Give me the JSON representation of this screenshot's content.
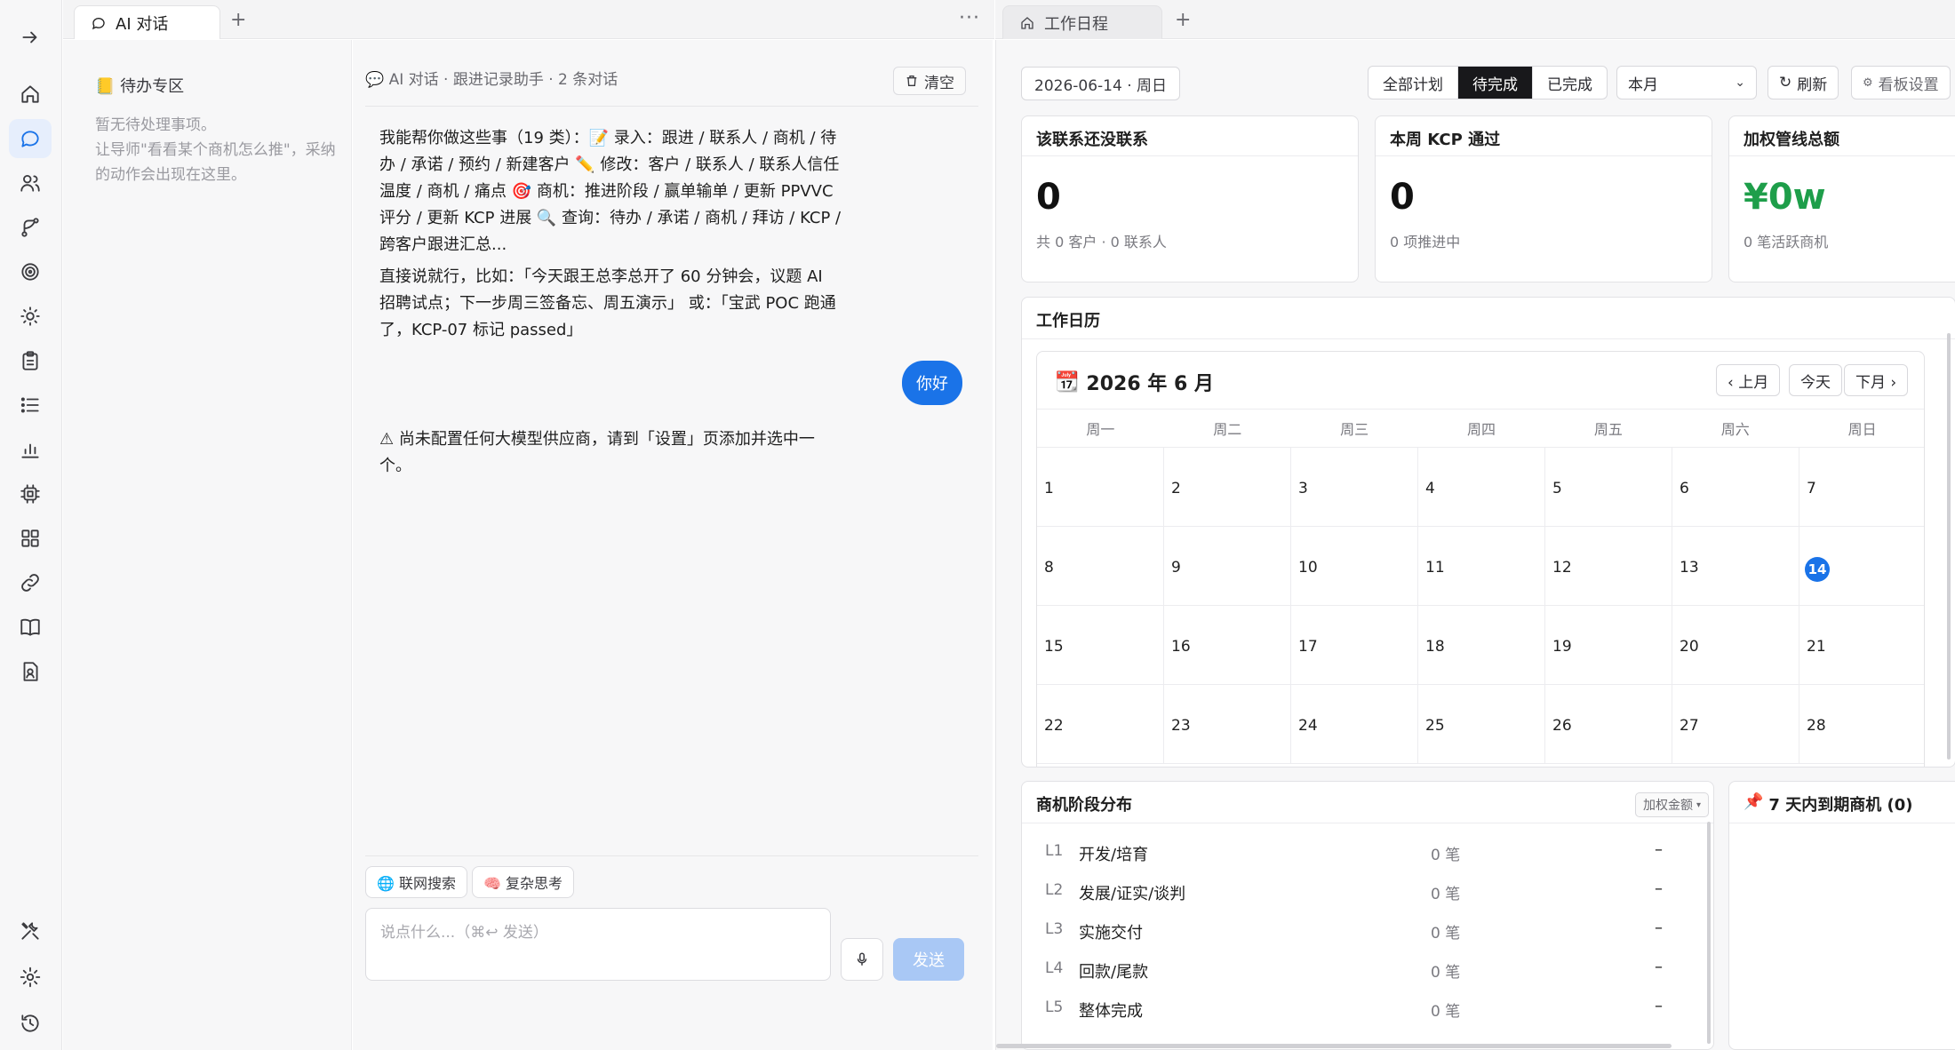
{
  "rail": {
    "items": [
      {
        "icon": "arrow-right-icon",
        "active": false
      },
      {
        "icon": "home-icon",
        "active": false
      },
      {
        "icon": "chat-bubble-icon",
        "active": true
      },
      {
        "icon": "users-icon",
        "active": false
      },
      {
        "icon": "branch-icon",
        "active": false
      },
      {
        "icon": "target-icon",
        "active": false
      },
      {
        "icon": "sun-icon",
        "active": false
      },
      {
        "icon": "clipboard-icon",
        "active": false
      },
      {
        "icon": "list-icon",
        "active": false
      },
      {
        "icon": "bar-chart-icon",
        "active": false
      },
      {
        "icon": "chip-icon",
        "active": false
      },
      {
        "icon": "grid-icon",
        "active": false
      },
      {
        "icon": "link-icon",
        "active": false
      },
      {
        "icon": "book-icon",
        "active": false
      },
      {
        "icon": "contact-file-icon",
        "active": false
      },
      {
        "icon": "tools-icon",
        "active": false
      },
      {
        "icon": "gear-icon",
        "active": false
      },
      {
        "icon": "history-icon",
        "active": false
      }
    ]
  },
  "left_tabs": {
    "tab_label": "AI 对话",
    "add": "+",
    "more": "···"
  },
  "right_tabs": {
    "tab_label": "工作日程",
    "add": "+"
  },
  "todo": {
    "title": "待办专区",
    "hint": "暂无待处理事项。\n让导师\"看看某个商机怎么推\"，采纳的动作会出现在这里。"
  },
  "chat": {
    "header": "💬 AI 对话 · 跟进记录助手 · 2 条对话",
    "clear_label": "清空",
    "intro": "我能帮你做这些事（19 类）：📝 录入：跟进 / 联系人 / 商机 / 待办 / 承诺 / 预约 / 新建客户 ✏️ 修改：客户 / 联系人 / 联系人信任温度 / 商机 / 痛点 🎯 商机：推进阶段 / 赢单输单 / 更新 PPVVC 评分 / 更新 KCP 进展 🔍 查询：待办 / 承诺 / 商机 / 拜访 / KCP / 跨客户跟进汇总...",
    "example": "直接说就行，比如：「今天跟王总李总开了 60 分钟会，议题 AI 招聘试点；下一步周三签备忘、周五演示」 或：「宝武 POC 跑通了，KCP-07 标记 passed」",
    "user_message": "你好",
    "warning": "⚠ 尚未配置任何大模型供应商，请到「设置」页添加并选中一个。",
    "chip_web": "🌐 联网搜索",
    "chip_think": "🧠 复杂思考",
    "input_placeholder": "说点什么...（⌘↩ 发送）",
    "send_label": "发送"
  },
  "toolbar": {
    "date": "2026-06-14 · 周日",
    "segments": [
      "全部计划",
      "待完成",
      "已完成"
    ],
    "active_segment": "待完成",
    "range": "本月",
    "refresh": "刷新",
    "board_settings": "看板设置"
  },
  "stats": [
    {
      "title": "该联系还没联系",
      "value": "0",
      "sub": "共 0 客户 · 0 联系人",
      "accent": "#111111"
    },
    {
      "title": "本周 KCP 通过",
      "value": "0",
      "sub": "0 项推进中",
      "accent": "#111111"
    },
    {
      "title": "加权管线总额",
      "value": "¥0w",
      "sub": "0 笔活跃商机",
      "accent": "#1e9e4a"
    }
  ],
  "calendar": {
    "card_title": "工作日历",
    "month_title": "2026 年 6 月",
    "prev": "‹ 上月",
    "today": "今天",
    "next": "下月 ›",
    "weekdays": [
      "周一",
      "周二",
      "周三",
      "周四",
      "周五",
      "周六",
      "周日"
    ],
    "weeks": [
      [
        "1",
        "2",
        "3",
        "4",
        "5",
        "6",
        "7"
      ],
      [
        "8",
        "9",
        "10",
        "11",
        "12",
        "13",
        "14"
      ],
      [
        "15",
        "16",
        "17",
        "18",
        "19",
        "20",
        "21"
      ],
      [
        "22",
        "23",
        "24",
        "25",
        "26",
        "27",
        "28"
      ]
    ],
    "today_day": "14"
  },
  "stages": {
    "title": "商机阶段分布",
    "weight_button": "加权金额",
    "rows": [
      {
        "code": "L1",
        "name": "开发/培育",
        "count": "0 笔",
        "value": "–"
      },
      {
        "code": "L2",
        "name": "发展/证实/谈判",
        "count": "0 笔",
        "value": "–"
      },
      {
        "code": "L3",
        "name": "实施交付",
        "count": "0 笔",
        "value": "–"
      },
      {
        "code": "L4",
        "name": "回款/尾款",
        "count": "0 笔",
        "value": "–"
      },
      {
        "code": "L5",
        "name": "整体完成",
        "count": "0 笔",
        "value": "–"
      }
    ]
  },
  "due": {
    "title": "7 天内到期商机 (0)"
  },
  "colors": {
    "accent": "#1a73e8",
    "send_disabled": "#a9c8f5",
    "segment_active": "#18181b"
  }
}
